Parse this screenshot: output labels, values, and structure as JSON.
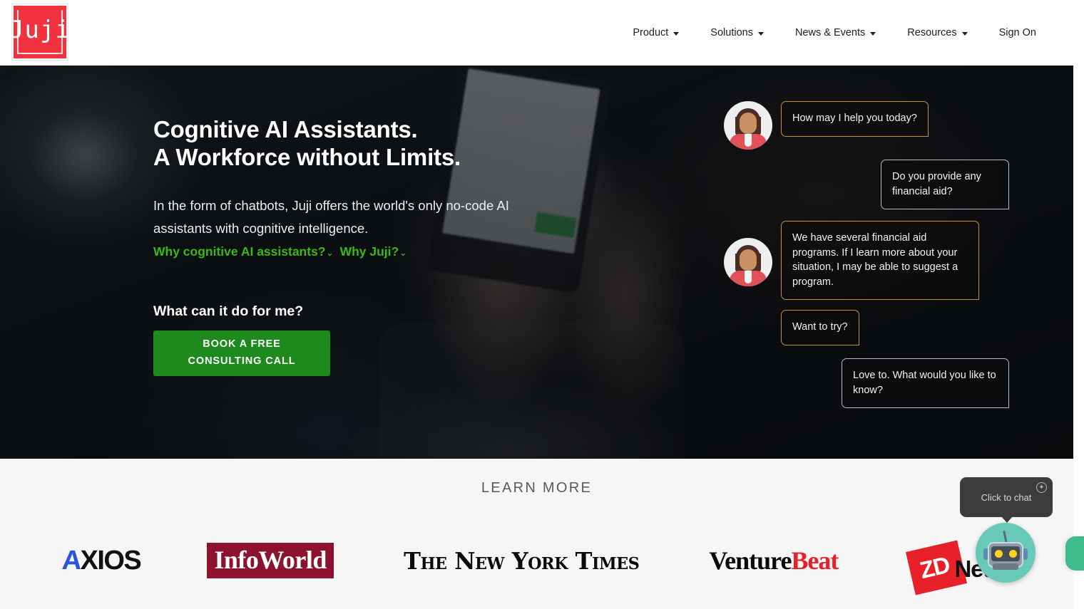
{
  "header": {
    "logo_text": "Juji",
    "logo_name": "juji-logo",
    "nav": [
      {
        "label": "Product",
        "has_caret": true
      },
      {
        "label": "Solutions",
        "has_caret": true
      },
      {
        "label": "News & Events",
        "has_caret": true
      },
      {
        "label": "Resources",
        "has_caret": true
      },
      {
        "label": "Sign On",
        "has_caret": false
      }
    ]
  },
  "hero": {
    "title_line1": "Cognitive AI Assistants.",
    "title_line2": "A Workforce without Limits.",
    "subtitle": "In the form of chatbots, Juji offers the world's only no-code AI assistants with cognitive intelligence.",
    "link1": "Why cognitive AI assistants?",
    "link2": "Why Juji?",
    "link_arrow": "⌄",
    "question": "What can it do for me?",
    "cta_line1": "BOOK A FREE",
    "cta_line2": "CONSULTING CALL",
    "accent_green": "#3cb814",
    "cta_green": "#1e8a1e"
  },
  "chat": {
    "bot_border_color": "#c8903a",
    "user_border_color": "#b9b9b9",
    "messages": [
      {
        "sender": "bot",
        "text": "How may I help you today?",
        "avatar": true
      },
      {
        "sender": "user",
        "text": "Do you provide any financial aid?",
        "avatar": false
      },
      {
        "sender": "bot",
        "text": "We have several financial aid programs. If I learn more about your situation, I may be able to suggest a program.",
        "avatar": true
      },
      {
        "sender": "bot",
        "text": "Want to try?",
        "avatar": false
      },
      {
        "sender": "user",
        "text": "Love to. What would you like to know?",
        "avatar": false
      }
    ]
  },
  "learn_more": {
    "title": "LEARN MORE",
    "brands": [
      {
        "name": "Axios",
        "part1": "A",
        "part2": "XIOS"
      },
      {
        "name": "InfoWorld",
        "text": "InfoWorld",
        "color": "#8c1230"
      },
      {
        "name": "The New York Times",
        "text": "The New York Times"
      },
      {
        "name": "VentureBeat",
        "part1": "Venture",
        "part2": "Beat",
        "accent": "#e8202a"
      },
      {
        "name": "ZDNet",
        "part1": "ZD",
        "part2": "Net",
        "color": "#e8202a"
      }
    ]
  },
  "widget": {
    "tooltip_text": "Click to chat",
    "close_glyph": "✦",
    "avatar_name": "robot-avatar",
    "accent": "#68c9b8",
    "side_tab_color": "#3fbb8e"
  }
}
